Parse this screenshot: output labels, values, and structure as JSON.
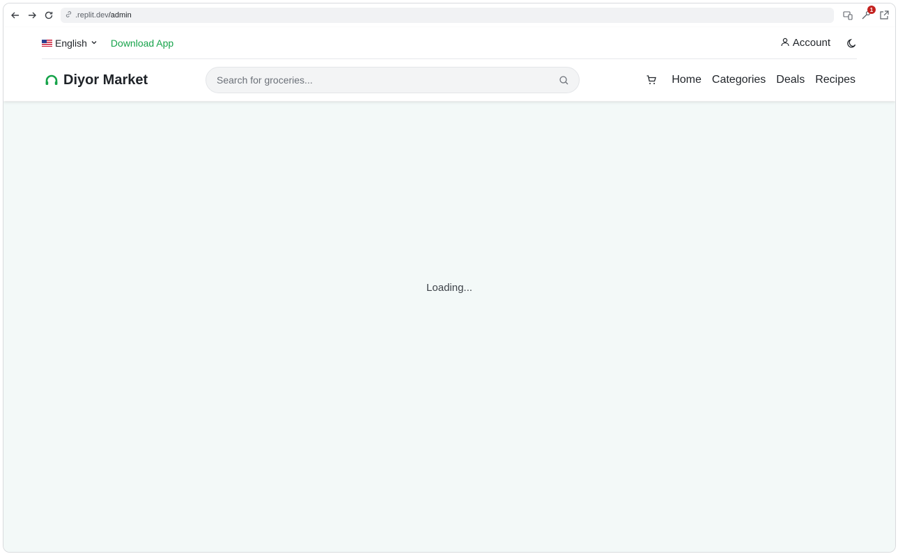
{
  "browser": {
    "url_host": ".replit.dev",
    "url_path": "/admin",
    "notification_count": "1"
  },
  "topbar": {
    "language": "English",
    "download_label": "Download App",
    "account_label": "Account"
  },
  "header": {
    "brand": "Diyor Market",
    "search_placeholder": "Search for groceries...",
    "nav": [
      "Home",
      "Categories",
      "Deals",
      "Recipes"
    ]
  },
  "main": {
    "status_text": "Loading..."
  },
  "colors": {
    "brand_green": "#16a34a",
    "content_bg": "#f3f9f8",
    "badge_red": "#c4221f"
  }
}
